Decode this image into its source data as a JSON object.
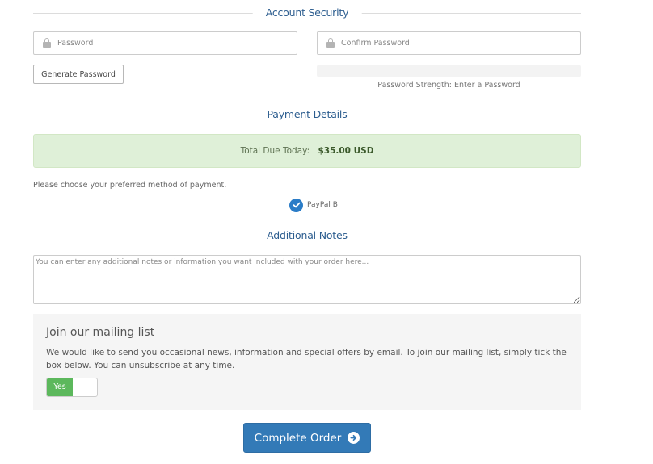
{
  "account_security": {
    "heading": "Account Security",
    "password_placeholder": "Password",
    "confirm_password_placeholder": "Confirm Password",
    "generate_password_label": "Generate Password",
    "strength_text": "Password Strength: Enter a Password",
    "strength_percent": 0
  },
  "payment_details": {
    "heading": "Payment Details",
    "total_due_label": "Total Due Today:",
    "total_due_amount": "$35.00 USD",
    "instruction": "Please choose your preferred method of payment.",
    "methods": [
      {
        "label": "PayPal B",
        "selected": true,
        "icon": "check-circle-icon"
      }
    ]
  },
  "additional_notes": {
    "heading": "Additional Notes",
    "placeholder": "You can enter any additional notes or information you want included with your order here...",
    "value": ""
  },
  "mailing_list": {
    "heading": "Join our mailing list",
    "description": "We would like to send you occasional news, information and special offers by email. To join our mailing list, simply tick the box below. You can unsubscribe at any time.",
    "toggle_label": "Yes",
    "toggle_on": true
  },
  "submit": {
    "label": "Complete Order",
    "icon": "arrow-circle-right-icon"
  },
  "colors": {
    "heading": "#2c5d8f",
    "success_bg": "#dff0d8",
    "primary": "#337ab7",
    "toggle_on": "#5cb85c",
    "check": "#2a7cc7"
  }
}
